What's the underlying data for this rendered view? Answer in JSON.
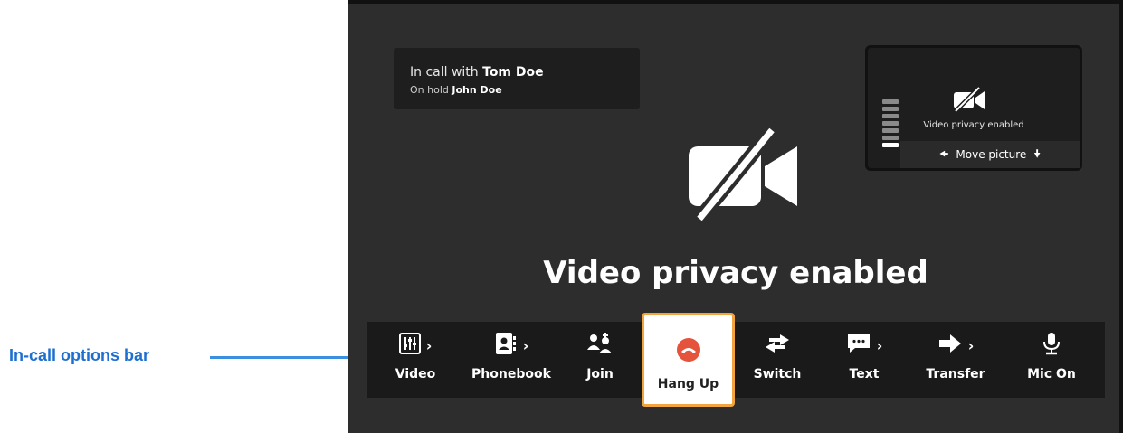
{
  "annotation": {
    "label": "In-call options bar"
  },
  "call_info": {
    "in_call_prefix": "In call with ",
    "in_call_name": "Tom Doe",
    "hold_prefix": "On hold ",
    "hold_name": "John Doe"
  },
  "self_view": {
    "status": "Video privacy enabled",
    "move_label": "Move picture",
    "level_bars_total": 7,
    "level_bars_active": 1
  },
  "main": {
    "status": "Video privacy enabled",
    "icon": "video-off-icon"
  },
  "options": [
    {
      "label": "Video",
      "icon": "sliders-icon",
      "submenu": true
    },
    {
      "label": "Phonebook",
      "icon": "phonebook-icon",
      "submenu": true
    },
    {
      "label": "Join",
      "icon": "join-icon",
      "submenu": false
    },
    {
      "label": "Hang Up",
      "icon": "hang-up-icon",
      "submenu": false,
      "selected": true
    },
    {
      "label": "Switch",
      "icon": "switch-icon",
      "submenu": false
    },
    {
      "label": "Text",
      "icon": "text-icon",
      "submenu": true
    },
    {
      "label": "Transfer",
      "icon": "transfer-icon",
      "submenu": true
    },
    {
      "label": "Mic On",
      "icon": "mic-icon",
      "submenu": false
    }
  ],
  "colors": {
    "background": "#2d2d2d",
    "bar": "#1a1a1a",
    "highlight_border": "#f2a53f",
    "hangup_red": "#e5533d",
    "annotation_blue": "#1d6fd1"
  }
}
